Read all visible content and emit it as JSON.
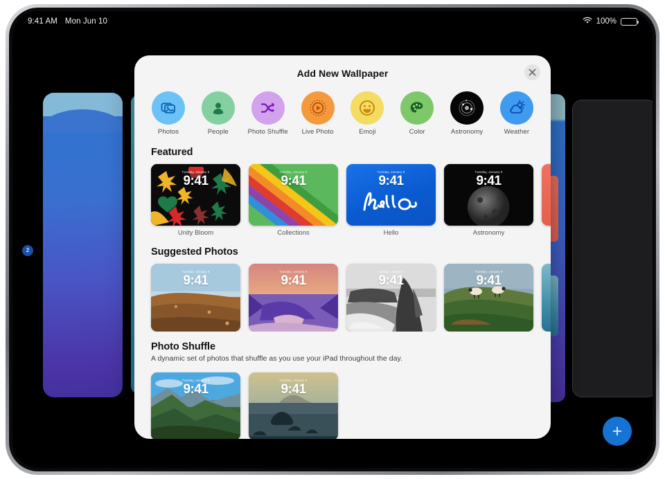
{
  "status_bar": {
    "time": "9:41 AM",
    "date": "Mon Jun 10",
    "wifi_icon": "wifi-icon",
    "battery_percent": "100%",
    "battery_icon": "battery-icon"
  },
  "sheet": {
    "title": "Add New Wallpaper",
    "close_icon": "close-icon",
    "categories": [
      {
        "label": "Photos",
        "icon": "photos-icon",
        "bg": "#6cc2f4",
        "fg": "#0a66b5"
      },
      {
        "label": "People",
        "icon": "people-icon",
        "bg": "#84d0a0",
        "fg": "#1f7a4a"
      },
      {
        "label": "Photo Shuffle",
        "icon": "shuffle-icon",
        "bg": "#d2a2ec",
        "fg": "#7b16c9"
      },
      {
        "label": "Live Photo",
        "icon": "live-photo-icon",
        "bg": "#f59a3c",
        "fg": "#b84c06"
      },
      {
        "label": "Emoji",
        "icon": "emoji-icon",
        "bg": "#f4db62",
        "fg": "#c98a0a"
      },
      {
        "label": "Color",
        "icon": "color-palette-icon",
        "bg": "#7ec86a",
        "fg": "#14651f"
      },
      {
        "label": "Astronomy",
        "icon": "astronomy-icon",
        "bg": "#060606",
        "fg": "#b9b9b9"
      },
      {
        "label": "Weather",
        "icon": "weather-icon",
        "bg": "#3e9bf0",
        "fg": "#0b4bb5"
      }
    ],
    "sections": [
      {
        "title": "Featured",
        "subtitle": "",
        "tiles": [
          {
            "caption": "Unity Bloom",
            "time": "9:41",
            "date": "Tuesday, January 9",
            "art": "art-unity"
          },
          {
            "caption": "Collections",
            "time": "9:41",
            "date": "Tuesday, January 9",
            "art": "art-collections"
          },
          {
            "caption": "Hello",
            "time": "9:41",
            "date": "Tuesday, January 9",
            "art": "art-hello"
          },
          {
            "caption": "Astronomy",
            "time": "9:41",
            "date": "Tuesday, January 9",
            "art": "art-astro"
          }
        ]
      },
      {
        "title": "Suggested Photos",
        "subtitle": "",
        "tiles": [
          {
            "caption": "",
            "time": "9:41",
            "date": "Tuesday, January 9",
            "art": "art-p1"
          },
          {
            "caption": "",
            "time": "9:41",
            "date": "Tuesday, January 9",
            "art": "art-p2"
          },
          {
            "caption": "",
            "time": "9:41",
            "date": "Tuesday, January 9",
            "art": "art-p3"
          },
          {
            "caption": "",
            "time": "9:41",
            "date": "Tuesday, January 9",
            "art": "art-p4"
          }
        ]
      },
      {
        "title": "Photo Shuffle",
        "subtitle": "A dynamic set of photos that shuffle as you use your iPad throughout the day.",
        "tiles": [
          {
            "caption": "",
            "time": "9:41",
            "date": "Tuesday, January 9",
            "art": "art-s1"
          },
          {
            "caption": "",
            "time": "9:41",
            "date": "Tuesday, January 9",
            "art": "art-s2"
          }
        ]
      }
    ]
  },
  "background": {
    "marker_label": "2",
    "add_button_label": "+",
    "add_button_color": "#1573d4"
  }
}
